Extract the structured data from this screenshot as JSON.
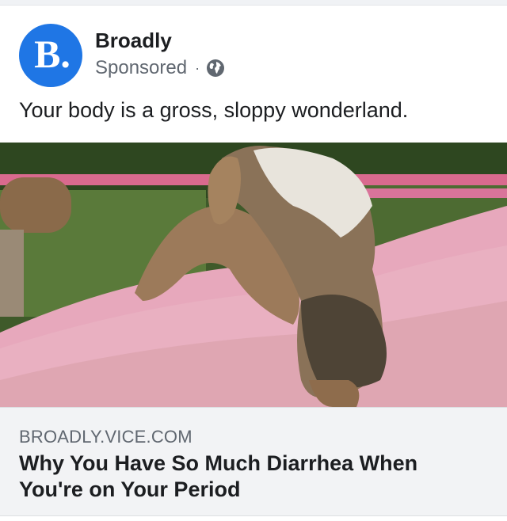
{
  "post": {
    "page_name": "Broadly",
    "avatar_letter": "B.",
    "sponsored_label": "Sponsored",
    "separator": "·",
    "privacy_icon": "globe-icon",
    "caption": "Your body is a gross, sloppy wonderland."
  },
  "link_preview": {
    "domain": "BROADLY.VICE.COM",
    "headline": "Why You Have So Much Diarrhea When You're on Your Period",
    "image_description": "muddy obstacle course participant climbing over a pink wall"
  },
  "colors": {
    "brand_blue": "#1f76e5",
    "meta_gray": "#606770",
    "link_bg": "#f2f3f5"
  }
}
